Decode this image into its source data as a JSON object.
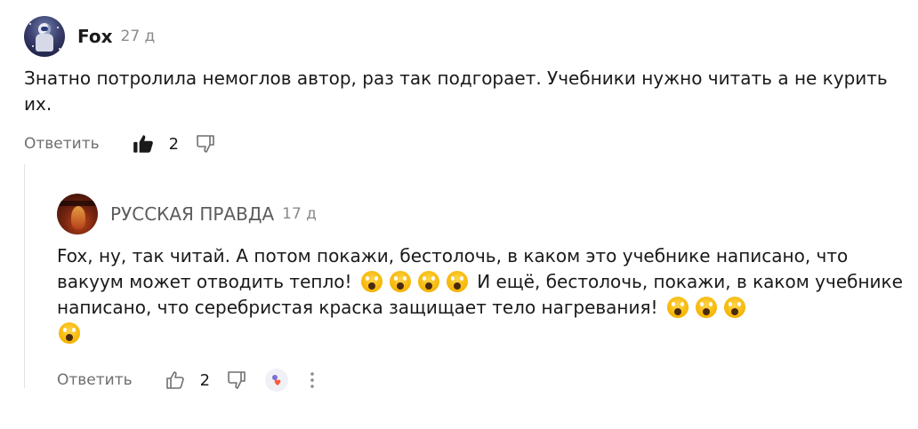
{
  "comment1": {
    "author": "Fox",
    "time": "27 д",
    "text": "Знатно потролила немоглов автор, раз так подгорает. Учебники нужно читать а не курить их.",
    "reply_label": "Ответить",
    "likes": "2",
    "avatar_icon": "astronaut-avatar"
  },
  "comment2": {
    "author": "РУССКАЯ ПРАВДА",
    "time": "17 д",
    "text_part1": "Fox, ну, так читай. А потом покажи, бестолочь, в каком это учебнике написано, что вакуум может отводить тепло!",
    "text_part2": " И ещё, бестолочь, покажи, в каком учебнике написано, что серебристая краска защищает тело нагревания!",
    "reply_label": "Ответить",
    "likes": "2",
    "avatar_icon": "flame-avatar"
  },
  "colors": {
    "text": "#1a1a1a",
    "muted": "#6f6f6f",
    "time": "#8a8a8a",
    "thread_line": "#e3e3e3"
  }
}
